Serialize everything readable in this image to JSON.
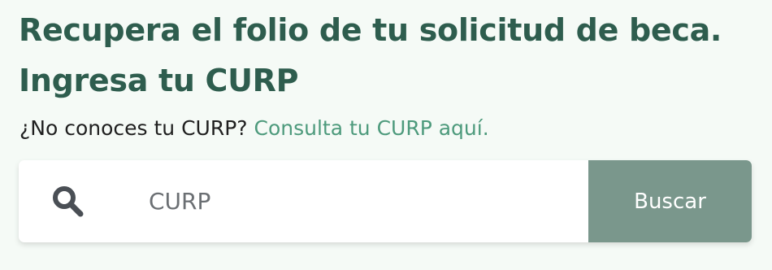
{
  "heading": {
    "title": "Recupera el folio de tu solicitud de beca. Ingresa tu CURP"
  },
  "subheading": {
    "question": "¿No conoces tu CURP?",
    "link_text": "Consulta tu CURP aquí."
  },
  "search": {
    "icon": "search-icon",
    "placeholder": "CURP",
    "value": "",
    "button_label": "Buscar"
  },
  "colors": {
    "title": "#2e5d4e",
    "link": "#4d9a7c",
    "button_background": "#7a978c",
    "page_background": "#f5faf6"
  }
}
